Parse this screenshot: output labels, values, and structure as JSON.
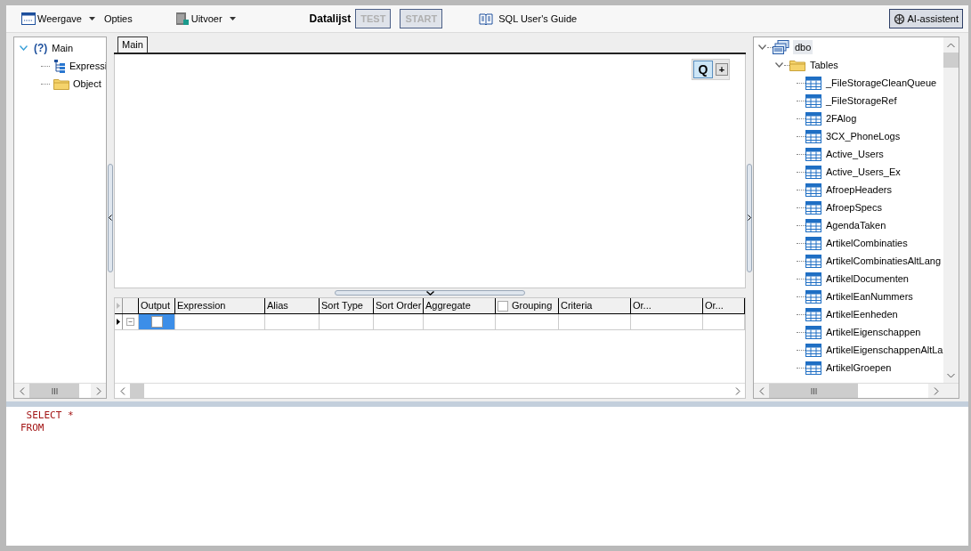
{
  "toolbar": {
    "items": [
      {
        "kind": "dropdown",
        "label": "Weergave"
      },
      {
        "kind": "menu",
        "label": "Opties"
      },
      {
        "kind": "dropdown",
        "label": "Uitvoer"
      },
      {
        "kind": "label",
        "label": "Datalijst"
      },
      {
        "kind": "button",
        "label": "TEST",
        "disabled": true
      },
      {
        "kind": "button",
        "label": "START",
        "disabled": true
      },
      {
        "kind": "link",
        "label": "SQL User's Guide"
      }
    ],
    "assistant": {
      "label": "AI-assistent",
      "pressed": true
    }
  },
  "query_tree": {
    "badge": "(?)",
    "label": "Main",
    "expanded": true,
    "children": [
      {
        "label": "Expressi"
      },
      {
        "label": "Object"
      }
    ]
  },
  "tabs": [
    {
      "label": "Main",
      "selected": true
    }
  ],
  "canvas_buttons": [
    {
      "label": "Q",
      "selected": true
    },
    {
      "label": "+",
      "selected": false
    }
  ],
  "grid": {
    "columns": [
      {
        "label": "Output"
      },
      {
        "label": "Expression"
      },
      {
        "label": "Alias"
      },
      {
        "label": "Sort Type"
      },
      {
        "label": "Sort Order"
      },
      {
        "label": "Aggregate"
      },
      {
        "label": "Grouping",
        "checked": false
      },
      {
        "label": "Criteria"
      },
      {
        "label": "Or..."
      },
      {
        "label": "Or..."
      }
    ],
    "rows": [
      {
        "current": true,
        "output_checked": false,
        "output_selected": true
      }
    ]
  },
  "schema_tree": {
    "label": "dbo",
    "expanded": true,
    "selected": true,
    "children": [
      {
        "label": "Tables",
        "expanded": true,
        "selected": false,
        "children": [
          {
            "label": "_FileStorageCleanQueue",
            "selected": false
          },
          {
            "label": "_FileStorageRef",
            "selected": false
          },
          {
            "label": "2FAlog",
            "selected": false
          },
          {
            "label": "3CX_PhoneLogs",
            "selected": false
          },
          {
            "label": "Active_Users",
            "selected": false
          },
          {
            "label": "Active_Users_Ex",
            "selected": false
          },
          {
            "label": "AfroepHeaders",
            "selected": false
          },
          {
            "label": "AfroepSpecs",
            "selected": false
          },
          {
            "label": "AgendaTaken",
            "selected": false
          },
          {
            "label": "ArtikelCombinaties",
            "selected": false
          },
          {
            "label": "ArtikelCombinatiesAltLang",
            "selected": false
          },
          {
            "label": "ArtikelDocumenten",
            "selected": false
          },
          {
            "label": "ArtikelEanNummers",
            "selected": false
          },
          {
            "label": "ArtikelEenheden",
            "selected": false
          },
          {
            "label": "ArtikelEigenschappen",
            "selected": false
          },
          {
            "label": "ArtikelEigenschappenAltLa",
            "selected": false
          },
          {
            "label": "ArtikelGroepen",
            "selected": false
          }
        ]
      }
    ]
  },
  "sql": {
    "lines": [
      " SELECT *",
      "FROM"
    ]
  }
}
